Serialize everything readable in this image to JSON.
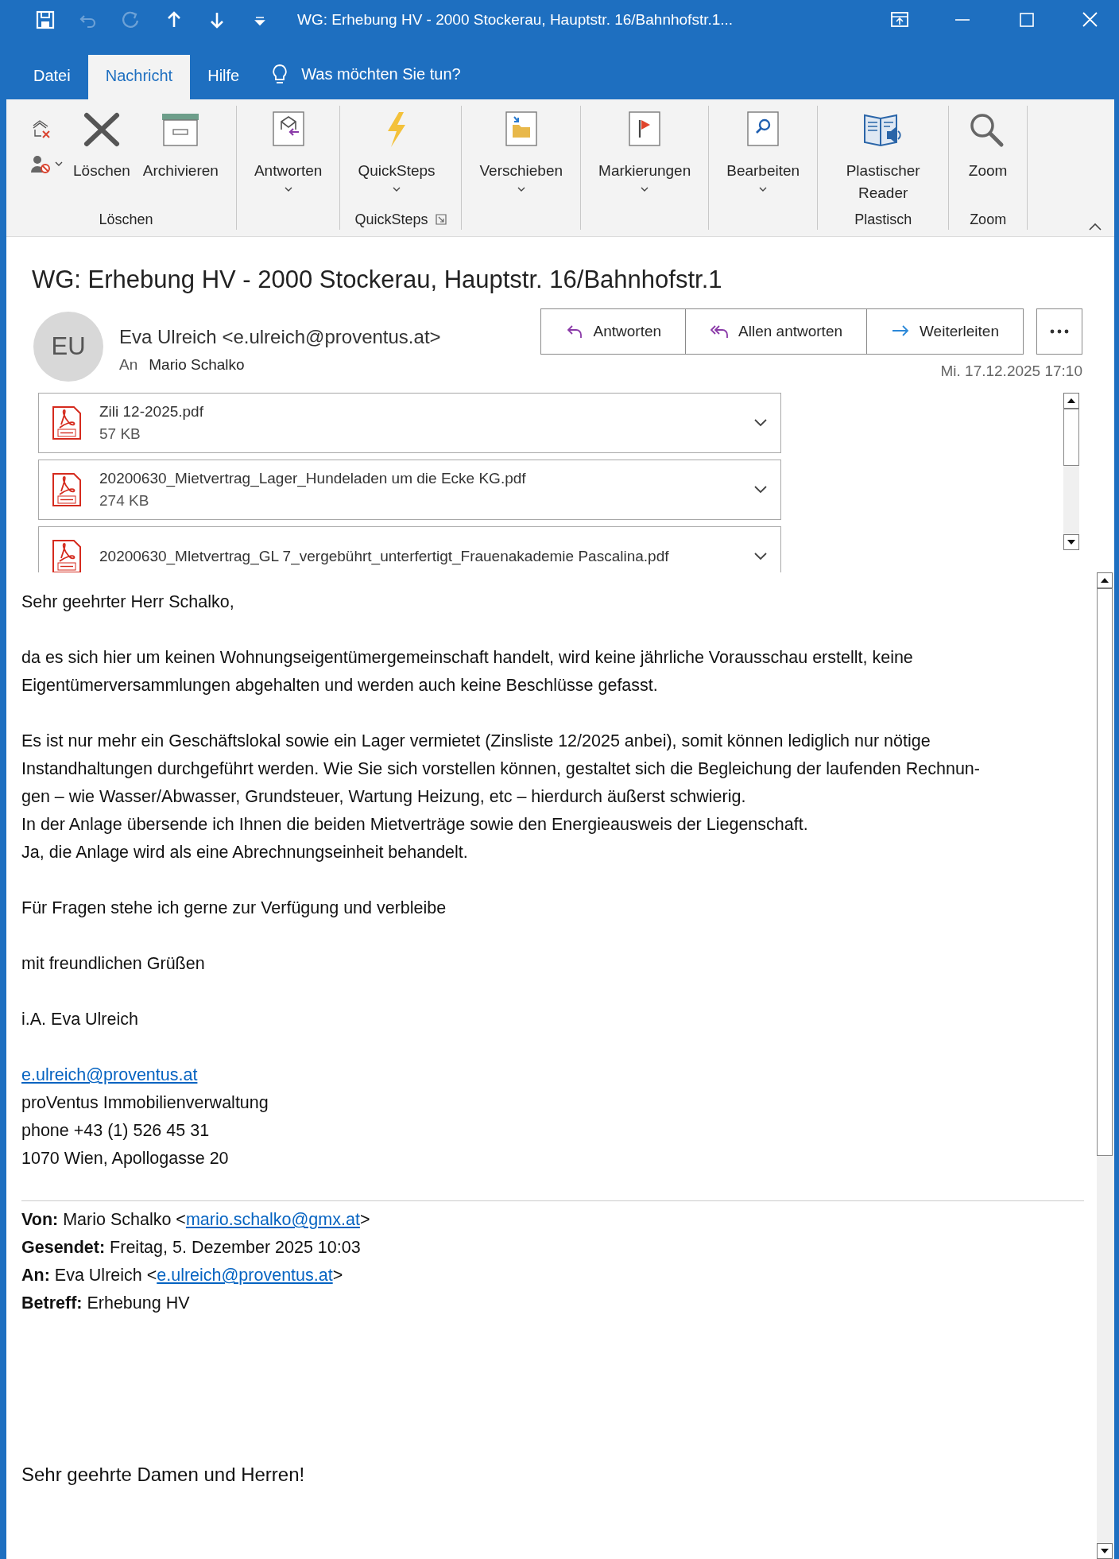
{
  "window": {
    "title": "WG: Erhebung HV - 2000 Stockerau, Hauptstr. 16/Bahnhofstr.1..."
  },
  "quick_access": [
    {
      "disabled": false
    },
    {
      "disabled": true
    },
    {
      "disabled": true
    },
    {
      "disabled": false
    },
    {
      "disabled": false
    },
    {
      "disabled": false
    }
  ],
  "tabs": [
    {
      "label": "Datei",
      "selected": false
    },
    {
      "label": "Nachricht",
      "selected": true
    },
    {
      "label": "Hilfe",
      "selected": false
    }
  ],
  "tell_me": {
    "placeholder": "Was möchten Sie tun?"
  },
  "ribbon": [
    {
      "label": "Löschen",
      "launcher": false,
      "buttons": [
        {
          "kind": "small"
        },
        {
          "kind": "large",
          "label": "Löschen",
          "dropdown": false
        },
        {
          "kind": "large",
          "label": "Archivieren",
          "dropdown": false
        }
      ]
    },
    {
      "buttons": [
        {
          "kind": "large",
          "label": "Antworten",
          "dropdown": true
        }
      ]
    },
    {
      "label": "QuickSteps",
      "launcher": true,
      "buttons": [
        {
          "kind": "large",
          "label": "QuickSteps",
          "dropdown": true
        }
      ]
    },
    {
      "buttons": [
        {
          "kind": "large",
          "label": "Verschieben",
          "dropdown": true
        }
      ]
    },
    {
      "buttons": [
        {
          "kind": "large",
          "label": "Markierungen",
          "dropdown": true
        }
      ]
    },
    {
      "buttons": [
        {
          "kind": "large",
          "label": "Bearbeiten",
          "dropdown": true
        }
      ]
    },
    {
      "label": "Plastisch",
      "launcher": false,
      "buttons": [
        {
          "kind": "large",
          "label": "Plastischer Reader",
          "dropdown": false
        }
      ]
    },
    {
      "label": "Zoom",
      "launcher": false,
      "buttons": [
        {
          "kind": "large",
          "label": "Zoom",
          "dropdown": false
        }
      ]
    }
  ],
  "message": {
    "subject": "WG: Erhebung HV - 2000 Stockerau, Hauptstr. 16/Bahnhofstr.1",
    "initials": "EU",
    "sender": "Eva Ulreich <e.ulreich@proventus.at>",
    "to_label": "An",
    "to": "Mario Schalko",
    "date": "Mi. 17.12.2025 17:10",
    "actions": [
      {
        "label": "Antworten"
      },
      {
        "label": "Allen antworten"
      },
      {
        "label": "Weiterleiten"
      }
    ]
  },
  "attachments": [
    {
      "name": "Zili 12-2025.pdf",
      "size": "57 KB"
    },
    {
      "name": "20200630_Mietvertrag_Lager_Hundeladen um die Ecke KG.pdf",
      "size": "274 KB"
    },
    {
      "name": "20200630_Mletvertrag_GL 7_vergebührt_unterfertigt_Frauenakademie Pascalina.pdf"
    }
  ],
  "body": {
    "paragraphs": [
      [
        "Sehr geehrter Herr Schalko,"
      ],
      [
        "da es sich hier um keinen Wohnungseigentümergemeinschaft handelt, wird keine jährliche Vorausschau erstellt, keine",
        "Eigentümerversammlungen abgehalten und werden auch keine Beschlüsse gefasst."
      ],
      [
        "Es ist nur mehr ein Geschäftslokal sowie ein Lager vermietet (Zinsliste 12/2025 anbei), somit können lediglich nur nötige",
        "Instandhaltungen durchgeführt werden. Wie Sie sich vorstellen können, gestaltet sich die Begleichung der laufenden Rechnun-",
        "gen – wie Wasser/Abwasser, Grundsteuer, Wartung Heizung, etc – hierdurch äußerst schwierig.",
        "In der Anlage übersende ich Ihnen die beiden Mietverträge sowie den Energieausweis der Liegenschaft.",
        "Ja, die Anlage wird als eine Abrechnungseinheit behandelt."
      ],
      [
        "Für Fragen stehe ich gerne zur Verfügung und verbleibe"
      ],
      [
        "mit freundlichen Grüßen"
      ],
      [
        "i.A. Eva Ulreich"
      ]
    ],
    "signature": {
      "email": "e.ulreich@proventus.at",
      "lines": [
        "proVentus Immobilienverwaltung",
        "phone +43 (1) 526 45 31",
        "1070 Wien, Apollogasse 20"
      ]
    },
    "forwarded": [
      {
        "label": "Von:",
        "text": "Mario Schalko <",
        "link": "mario.schalko@gmx.at",
        "after": ">"
      },
      {
        "label": "Gesendet:",
        "text": "Freitag, 5. Dezember 2025 10:03"
      },
      {
        "label": "An:",
        "text": "Eva Ulreich <",
        "link": "e.ulreich@proventus.at",
        "after": ">"
      },
      {
        "label": "Betreff:",
        "text": "Erhebung HV"
      }
    ],
    "greeting": "Sehr geehrte Damen und Herren!"
  }
}
